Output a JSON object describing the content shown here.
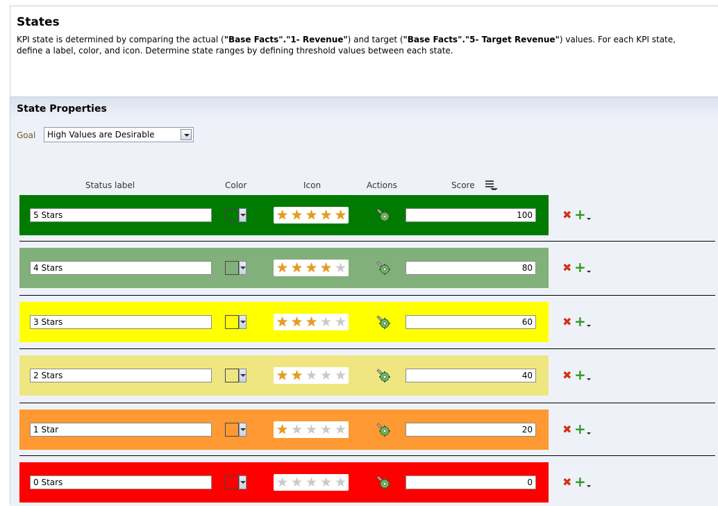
{
  "header": {
    "title": "States",
    "desc_parts": [
      "KPI state is determined by comparing the actual (",
      "\"Base Facts\".\"1- Revenue\"",
      ") and target (",
      "\"Base Facts\".\"5- Target Revenue\"",
      ") values. For each KPI state, define a label, color, and icon. Determine state ranges by defining threshold values between each state."
    ]
  },
  "state_properties": {
    "title": "State Properties",
    "goal_label": "Goal",
    "goal_value": "High Values are Desirable"
  },
  "columns": {
    "status_label": "Status label",
    "color": "Color",
    "icon": "Icon",
    "actions": "Actions",
    "score": "Score"
  },
  "states": [
    {
      "label": "5 Stars",
      "color": "#007a00",
      "swatch": "#007a00",
      "stars": 5,
      "score": "100"
    },
    {
      "label": "4 Stars",
      "color": "#82b07a",
      "swatch": "#82b07a",
      "stars": 4,
      "score": "80"
    },
    {
      "label": "3 Stars",
      "color": "#ffff00",
      "swatch": "#ffff00",
      "stars": 3,
      "score": "60"
    },
    {
      "label": "2 Stars",
      "color": "#efe682",
      "swatch": "#efe682",
      "stars": 2,
      "score": "40"
    },
    {
      "label": "1 Star",
      "color": "#ff9933",
      "swatch": "#ff9933",
      "stars": 1,
      "score": "20"
    },
    {
      "label": "0 Stars",
      "color": "#ff0000",
      "swatch": "#ff0000",
      "stars": 0,
      "score": "0"
    }
  ],
  "icons": {
    "score_sort": "list-sort-icon",
    "action": "gear-wrench-icon",
    "delete": "delete-x-icon",
    "add": "add-plus-icon"
  }
}
